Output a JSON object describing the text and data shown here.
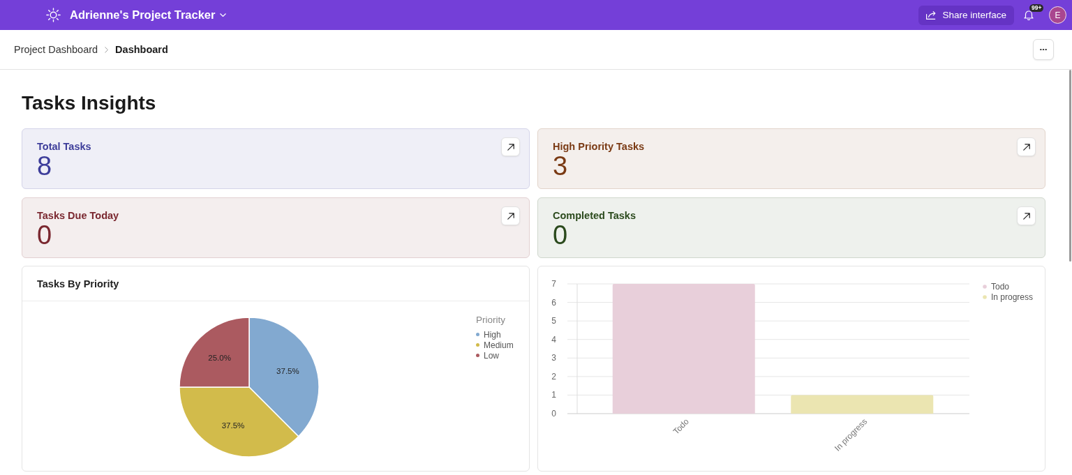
{
  "header": {
    "title": "Adrienne's Project Tracker",
    "share_button": "Share interface",
    "notification_badge": "99+",
    "avatar_initial": "E"
  },
  "breadcrumb": [
    {
      "label": "Project Dashboard",
      "current": false
    },
    {
      "label": "Dashboard",
      "current": true
    }
  ],
  "page_title": "Tasks Insights",
  "stats": [
    {
      "label": "Total Tasks",
      "value": "8",
      "color": "#3d3d9a"
    },
    {
      "label": "High Priority Tasks",
      "value": "3",
      "color": "#7a3a14"
    },
    {
      "label": "Tasks Due Today",
      "value": "0",
      "color": "#7a2830"
    },
    {
      "label": "Completed Tasks",
      "value": "0",
      "color": "#2b4a1d"
    }
  ],
  "priority_chart": {
    "legend_title": "Priority",
    "chart_data": {
      "type": "pie",
      "title": "Tasks By Priority",
      "categories": [
        "High",
        "Medium",
        "Low"
      ],
      "values": [
        37.5,
        37.5,
        25.0
      ],
      "colors": [
        "#82a9d0",
        "#d2bb4b",
        "#ab5a60"
      ],
      "value_labels": [
        "37.5%",
        "37.5%",
        "25.0%"
      ]
    }
  },
  "status_chart": {
    "chart_data": {
      "type": "bar",
      "categories": [
        "Todo",
        "In progress"
      ],
      "series": [
        {
          "name": "Todo",
          "color": "#e8cfda",
          "values": [
            7,
            null
          ]
        },
        {
          "name": "In progress",
          "color": "#ebe5b1",
          "values": [
            null,
            1
          ]
        }
      ],
      "ylim": [
        0,
        7
      ],
      "yticks": [
        0,
        1,
        2,
        3,
        4,
        5,
        6,
        7
      ],
      "grid": true
    }
  }
}
